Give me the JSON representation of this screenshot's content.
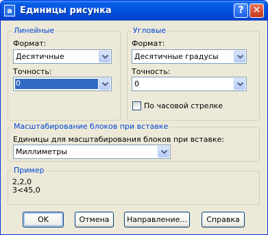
{
  "window": {
    "title": "Единицы рисунка",
    "icon_glyph": "a",
    "help_glyph": "?",
    "close_glyph": "✕"
  },
  "linear": {
    "group_title": "Линейные",
    "format_label": "Формат:",
    "format_value": "Десятичные",
    "precision_label": "Точность:",
    "precision_value": "0"
  },
  "angular": {
    "group_title": "Угловые",
    "format_label": "Формат:",
    "format_value": "Десятичные градусы",
    "precision_label": "Точность:",
    "precision_value": "0",
    "clockwise_label": "По часовой стрелке",
    "clockwise_checked": false
  },
  "scaling": {
    "group_title": "Масштабирование блоков при вставке",
    "units_label": "Единицы для масштабирования блоков при вставке:",
    "units_value": "Миллиметры"
  },
  "sample": {
    "group_title": "Пример",
    "line1": "2,2,0",
    "line2": "3<45,0"
  },
  "buttons": {
    "ok": "OK",
    "cancel": "Отмена",
    "direction": "Направление...",
    "help": "Справка"
  },
  "colors": {
    "titlebar": "#0054e3",
    "dialog_bg": "#ece9d8",
    "group_title": "#0046d5",
    "selection": "#316ac5"
  }
}
